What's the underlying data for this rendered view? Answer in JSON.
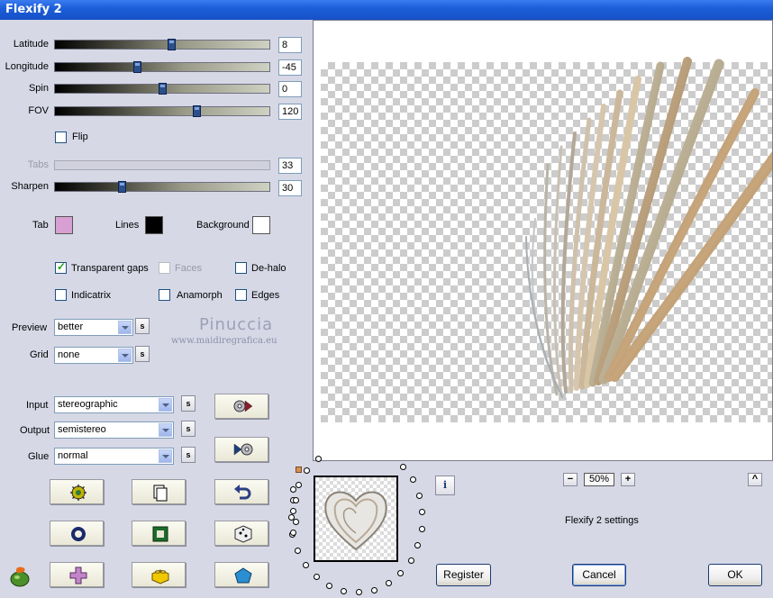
{
  "window": {
    "title": "Flexify 2"
  },
  "sliders": [
    {
      "label": "Latitude",
      "value": "8",
      "fraction": 0.54,
      "enabled": true
    },
    {
      "label": "Longitude",
      "value": "-45",
      "fraction": 0.38,
      "enabled": true
    },
    {
      "label": "Spin",
      "value": "0",
      "fraction": 0.5,
      "enabled": true
    },
    {
      "label": "FOV",
      "value": "120",
      "fraction": 0.66,
      "enabled": true
    },
    {
      "label": "Tabs",
      "value": "33",
      "enabled": false
    },
    {
      "label": "Sharpen",
      "value": "30",
      "fraction": 0.3,
      "enabled": true
    }
  ],
  "flip": {
    "label": "Flip",
    "checked": false
  },
  "colors": {
    "tab": {
      "label": "Tab",
      "color": "#d8a0d2"
    },
    "lines": {
      "label": "Lines",
      "color": "#000000"
    },
    "background": {
      "label": "Background",
      "color": "#ffffff"
    }
  },
  "options": {
    "transparent_gaps": {
      "label": "Transparent gaps",
      "checked": true
    },
    "faces": {
      "label": "Faces",
      "checked": false,
      "enabled": false
    },
    "de_halo": {
      "label": "De-halo",
      "checked": false
    },
    "indicatrix": {
      "label": "Indicatrix",
      "checked": false
    },
    "anamorph": {
      "label": "Anamorph",
      "checked": false
    },
    "edges": {
      "label": "Edges",
      "checked": false
    }
  },
  "preview_select": {
    "label": "Preview",
    "value": "better"
  },
  "grid_select": {
    "label": "Grid",
    "value": "none"
  },
  "projection": {
    "input": {
      "label": "Input",
      "value": "stereographic"
    },
    "output": {
      "label": "Output",
      "value": "semistereo"
    },
    "glue": {
      "label": "Glue",
      "value": "normal"
    }
  },
  "s_label": "s",
  "watermark": {
    "name": "Pinuccia",
    "url": "www.maidiregrafica.eu"
  },
  "zoom": {
    "minus": "−",
    "value": "50%",
    "plus": "+"
  },
  "scroll_up": "^",
  "settings_label": "Flexify 2 settings",
  "info_label": "i",
  "buttons": {
    "register": "Register",
    "cancel": "Cancel",
    "ok": "OK"
  }
}
